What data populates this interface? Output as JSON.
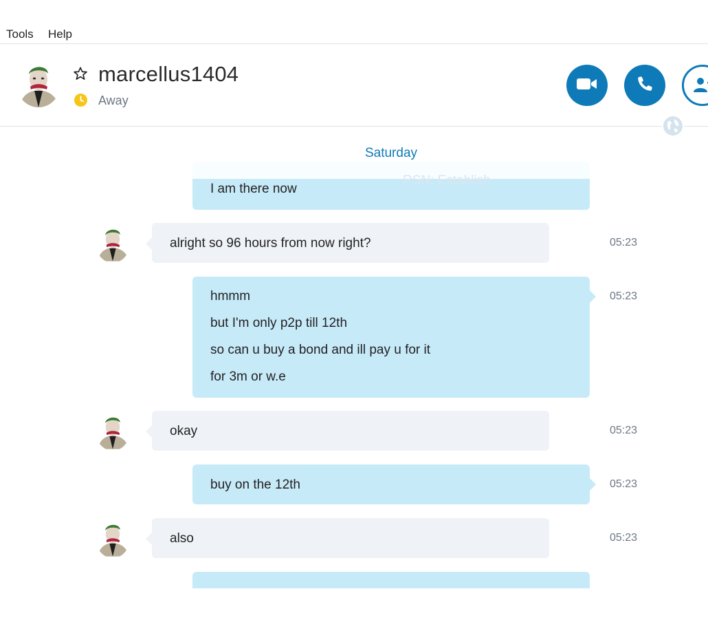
{
  "menu": {
    "items": [
      "Tools",
      "Help"
    ]
  },
  "contact": {
    "name": "marcellus1404",
    "status": "Away"
  },
  "chat": {
    "day_label": "Saturday",
    "faded_text": "RSN: Establish",
    "messages": [
      {
        "direction": "out",
        "lines": [
          "I am there now"
        ],
        "time": ""
      },
      {
        "direction": "in",
        "lines": [
          "alright so 96 hours from now right?"
        ],
        "time": "05:23"
      },
      {
        "direction": "out",
        "lines": [
          "hmmm",
          "but I'm only p2p till 12th",
          "so can u buy a bond and ill pay u for it",
          "for 3m or w.e"
        ],
        "time": "05:23"
      },
      {
        "direction": "in",
        "lines": [
          "okay"
        ],
        "time": "05:23"
      },
      {
        "direction": "out",
        "lines": [
          "buy on the 12th"
        ],
        "time": "05:23"
      },
      {
        "direction": "in",
        "lines": [
          "also"
        ],
        "time": "05:23"
      }
    ]
  },
  "icons": {
    "favorite": "star-icon",
    "status": "clock-icon",
    "video_call": "video-camera-icon",
    "audio_call": "phone-icon",
    "add_contact": "add-person-icon",
    "translator": "globe-icon"
  },
  "colors": {
    "accent": "#0e7ab8",
    "outgoing_bubble": "#c7eaf9",
    "incoming_bubble": "#eff2f6",
    "away": "#f5c518"
  }
}
